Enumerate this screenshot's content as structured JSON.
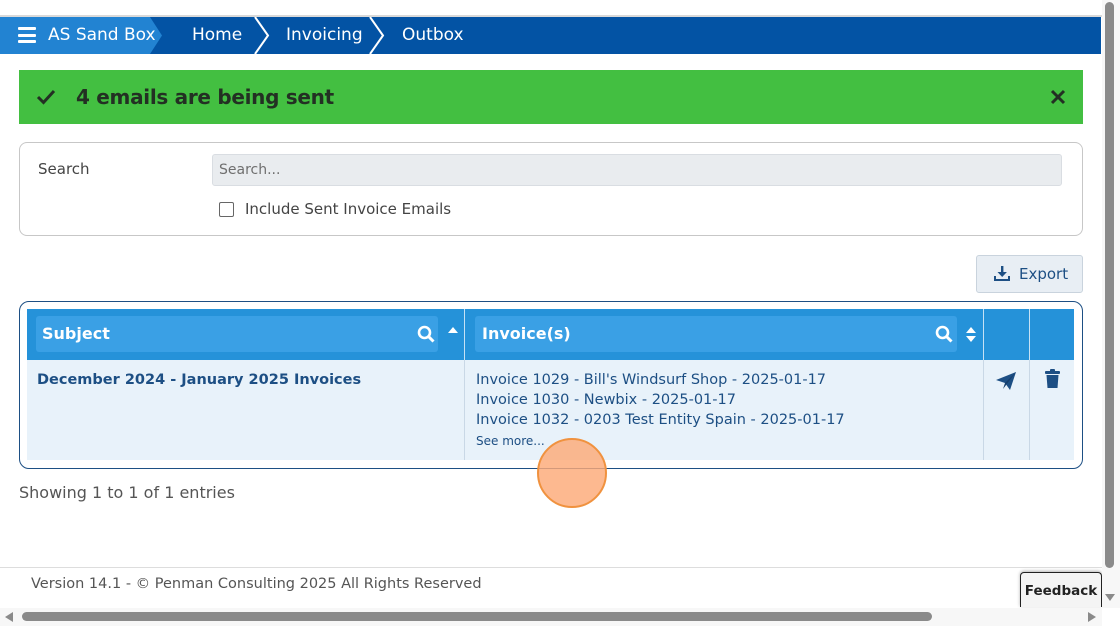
{
  "breadcrumb": {
    "menu_icon": "hamburger-icon",
    "items": [
      "AS Sand Box",
      "Home",
      "Invoicing",
      "Outbox"
    ]
  },
  "alert": {
    "icon": "check-icon",
    "message": "4 emails are being sent",
    "close_icon": "close-icon",
    "background": "#43bf41"
  },
  "search": {
    "label": "Search",
    "placeholder": "Search...",
    "value": "",
    "include_sent_label": "Include Sent Invoice Emails",
    "include_sent_checked": false
  },
  "toolbar": {
    "export_label": "Export",
    "export_icon": "download-icon"
  },
  "table": {
    "columns": [
      {
        "label": "Subject",
        "search_icon": "search-icon",
        "sort_icon": "sort-asc-icon"
      },
      {
        "label": "Invoice(s)",
        "search_icon": "search-icon",
        "sort_icon": "sort-icon"
      }
    ],
    "rows": [
      {
        "subject": "December 2024 - January 2025 Invoices",
        "invoices": [
          "Invoice 1029 - Bill's Windsurf Shop - 2025-01-17",
          "Invoice 1030 - Newbix - 2025-01-17",
          "Invoice 1032 - 0203 Test Entity Spain - 2025-01-17"
        ],
        "see_more": "See more...",
        "send_icon": "send-icon",
        "delete_icon": "trash-icon"
      }
    ],
    "header_color": "#2592d9",
    "row_color": "#e8f2fa",
    "text_color": "#1d4f84"
  },
  "showing": "Showing 1 to 1 of 1 entries",
  "footer": {
    "text": "Version 14.1 - © Penman Consulting 2025 All Rights Reserved",
    "feedback_label": "Feedback"
  },
  "colors": {
    "nav_bar": "#0353a4",
    "nav_first": "#2283d2"
  }
}
